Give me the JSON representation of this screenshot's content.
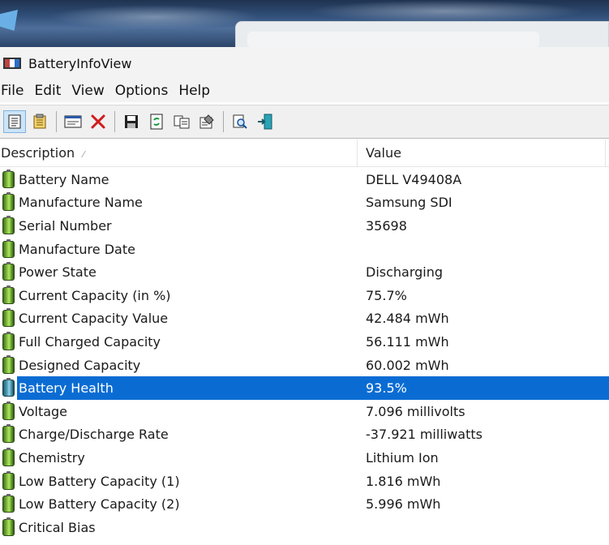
{
  "window": {
    "title": "BatteryInfoView"
  },
  "menu": [
    "File",
    "Edit",
    "View",
    "Options",
    "Help"
  ],
  "toolbar": {
    "buttons": [
      {
        "icon": "html-report-icon",
        "active": true
      },
      {
        "icon": "notes-icon",
        "active": false
      },
      {
        "icon": "properties-window-icon",
        "active": false
      },
      {
        "icon": "delete-red-x-icon",
        "active": false
      },
      {
        "icon": "save-floppy-icon",
        "active": false
      },
      {
        "icon": "refresh-icon",
        "active": false
      },
      {
        "icon": "copy-icon",
        "active": false
      },
      {
        "icon": "properties-icon",
        "active": false
      },
      {
        "icon": "find-icon",
        "active": false
      },
      {
        "icon": "exit-icon",
        "active": false
      }
    ]
  },
  "columns": {
    "description": "Description",
    "value": "Value"
  },
  "rows": [
    {
      "label": "Battery Name",
      "value": "DELL V49408A"
    },
    {
      "label": "Manufacture Name",
      "value": "Samsung SDI"
    },
    {
      "label": "Serial Number",
      "value": "35698"
    },
    {
      "label": "Manufacture Date",
      "value": ""
    },
    {
      "label": "Power State",
      "value": "Discharging"
    },
    {
      "label": "Current Capacity (in %)",
      "value": "75.7%"
    },
    {
      "label": "Current Capacity Value",
      "value": "42.484 mWh"
    },
    {
      "label": "Full Charged Capacity",
      "value": "56.111 mWh"
    },
    {
      "label": "Designed Capacity",
      "value": "60.002 mWh"
    },
    {
      "label": "Battery Health",
      "value": "93.5%",
      "selected": true
    },
    {
      "label": "Voltage",
      "value": "7.096 millivolts"
    },
    {
      "label": "Charge/Discharge Rate",
      "value": "-37.921 milliwatts"
    },
    {
      "label": "Chemistry",
      "value": "Lithium Ion"
    },
    {
      "label": "Low Battery Capacity (1)",
      "value": "1.816 mWh"
    },
    {
      "label": "Low Battery Capacity (2)",
      "value": "5.996 mWh"
    },
    {
      "label": "Critical Bias",
      "value": ""
    }
  ],
  "colors": {
    "selection": "#0a6cd3",
    "toolbar_bg": "#f0f0f0",
    "titlebar_bg": "#f3f3f3"
  }
}
